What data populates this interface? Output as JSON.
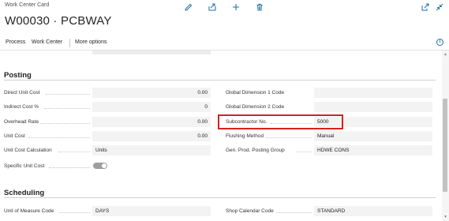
{
  "header": {
    "card_label": "Work Center Card",
    "title": "W00030 · PCBWAY",
    "icons": [
      "edit-icon",
      "share-icon",
      "add-icon",
      "delete-icon",
      "open-new-window-icon",
      "collapse-icon"
    ]
  },
  "actions": {
    "process": "Process",
    "work_center": "Work Center",
    "more_options": "More options"
  },
  "posting": {
    "header": "Posting",
    "left": [
      {
        "label": "Direct Unit Cost",
        "value": "0.00"
      },
      {
        "label": "Indirect Cost %",
        "value": "0"
      },
      {
        "label": "Overhead Rate",
        "value": "0.00"
      },
      {
        "label": "Unit Cost",
        "value": "0.00"
      },
      {
        "label": "Unit Cost Calculation",
        "value": "Units"
      },
      {
        "label": "Specific Unit Cost",
        "value": true
      }
    ],
    "right": [
      {
        "label": "Global Dimension 1 Code",
        "value": ""
      },
      {
        "label": "Global Dimension 2 Code",
        "value": ""
      },
      {
        "label": "Subcontractor No.",
        "value": "5000"
      },
      {
        "label": "Flushing Method",
        "value": "Manual"
      },
      {
        "label": "Gen. Prod. Posting Group",
        "value": "HDWE CONS"
      }
    ]
  },
  "scheduling": {
    "header": "Scheduling",
    "left": [
      {
        "label": "Unit of Measure Code",
        "value": "DAYS"
      }
    ],
    "right": [
      {
        "label": "Shop Calendar Code",
        "value": "STANDARD"
      }
    ]
  },
  "colors": {
    "accent": "#1d6fa8",
    "highlight": "#d92020",
    "field_bg": "#f3f3f3"
  }
}
